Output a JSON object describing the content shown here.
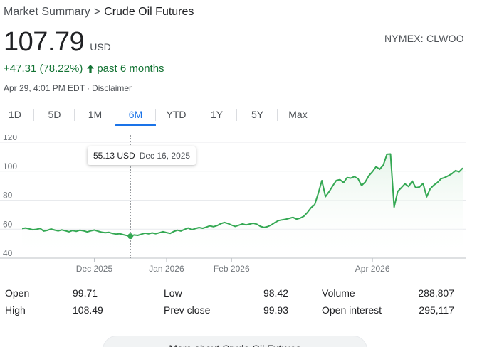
{
  "breadcrumb": {
    "root": "Market Summary",
    "separator": ">",
    "current": "Crude Oil Futures"
  },
  "quote": {
    "price": "107.79",
    "currency": "USD",
    "change": "+47.31 (78.22%)",
    "direction_icon": "arrow-up-icon",
    "period": "past 6 months",
    "exchange": "NYMEX: CLWOO",
    "timestamp": "Apr 29, 4:01 PM EDT",
    "dot": "·",
    "disclaimer": "Disclaimer"
  },
  "tabs": [
    {
      "label": "1D"
    },
    {
      "label": "5D"
    },
    {
      "label": "1M"
    },
    {
      "label": "6M",
      "active": true
    },
    {
      "label": "YTD"
    },
    {
      "label": "1Y"
    },
    {
      "label": "5Y"
    },
    {
      "label": "Max"
    }
  ],
  "tooltip": {
    "value": "55.13 USD",
    "date": "Dec 16, 2025"
  },
  "colors": {
    "line": "#34a853",
    "fill_top": "#e6f4ea",
    "accent": "#1a73e8",
    "positive": "#137333"
  },
  "chart_data": {
    "type": "area",
    "y_ticks": [
      40,
      60,
      80,
      100,
      120
    ],
    "ylim": [
      40,
      120
    ],
    "grid": true,
    "x_labels": [
      "Dec 2025",
      "Jan 2026",
      "Feb 2026",
      "Apr 2026"
    ],
    "x_label_index": [
      20,
      40,
      58,
      97
    ],
    "highlight_index": 30,
    "values": [
      60.4,
      60.8,
      60.2,
      59.6,
      59.9,
      60.5,
      58.7,
      59.2,
      60.1,
      59.4,
      58.8,
      59.5,
      58.9,
      58.2,
      59.1,
      58.5,
      59.3,
      58.9,
      58.1,
      58.8,
      59.4,
      58.6,
      57.9,
      57.5,
      57.8,
      57.1,
      56.6,
      56.9,
      56.2,
      55.6,
      55.13,
      56.0,
      55.7,
      56.5,
      57.3,
      56.8,
      57.4,
      56.9,
      57.5,
      58.2,
      57.6,
      57.1,
      58.4,
      59.3,
      58.7,
      59.9,
      60.8,
      59.6,
      60.4,
      61.1,
      60.6,
      61.4,
      62.3,
      61.7,
      62.5,
      63.8,
      64.6,
      63.9,
      62.8,
      61.9,
      62.7,
      63.6,
      62.9,
      63.5,
      64.1,
      63.4,
      61.9,
      61.2,
      61.8,
      62.9,
      64.6,
      65.9,
      66.4,
      66.8,
      67.5,
      68.1,
      66.9,
      67.6,
      68.9,
      71.5,
      74.8,
      76.9,
      84.6,
      93.5,
      82.4,
      85.9,
      89.8,
      93.6,
      94.2,
      92.1,
      95.6,
      95.2,
      96.3,
      94.8,
      90.1,
      92.5,
      96.9,
      99.7,
      103.1,
      101.4,
      104.2,
      111.7,
      111.9,
      75.2,
      86.1,
      88.6,
      91.3,
      89.4,
      93.2,
      88.6,
      89.1,
      91.6,
      82.3,
      87.9,
      90.4,
      92.2,
      94.8,
      95.6,
      96.9,
      98.3,
      100.4,
      99.6,
      102.2
    ]
  },
  "stats": [
    {
      "label": "Open",
      "value": "99.71"
    },
    {
      "label": "High",
      "value": "108.49"
    },
    {
      "label": "Low",
      "value": "98.42"
    },
    {
      "label": "Prev close",
      "value": "99.93"
    },
    {
      "label": "Volume",
      "value": "288,807"
    },
    {
      "label": "Open interest",
      "value": "295,117"
    }
  ],
  "more_button": "More about Crude Oil Futures"
}
